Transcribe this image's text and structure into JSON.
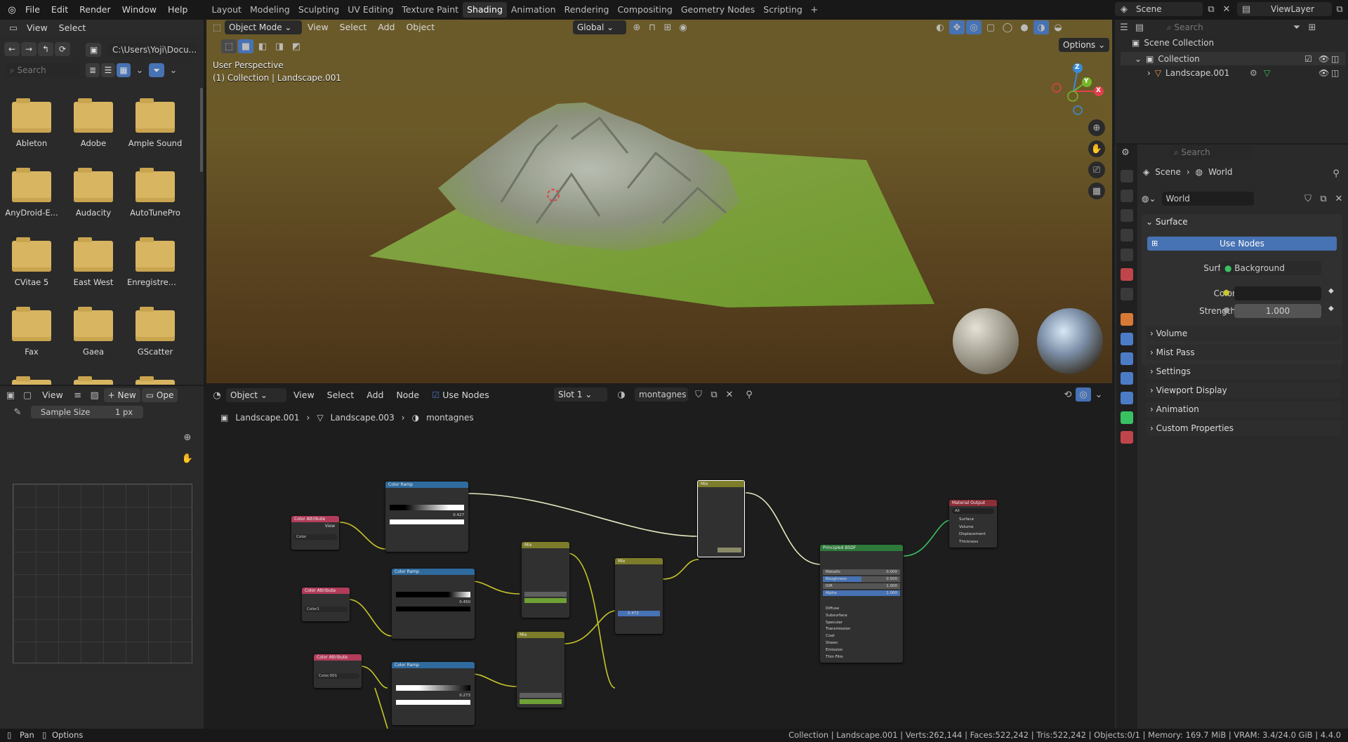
{
  "topbar": {
    "menus": [
      "File",
      "Edit",
      "Render",
      "Window",
      "Help"
    ],
    "workspaces": [
      "Layout",
      "Modeling",
      "Sculpting",
      "UV Editing",
      "Texture Paint",
      "Shading",
      "Animation",
      "Rendering",
      "Compositing",
      "Geometry Nodes",
      "Scripting"
    ],
    "active_workspace": "Shading",
    "scene": "Scene",
    "view_layer": "ViewLayer"
  },
  "file_browser": {
    "menus": [
      "View",
      "Select"
    ],
    "path": "C:\\Users\\Yoji\\Docu...",
    "search_placeholder": "Search",
    "folders": [
      "Ableton",
      "Adobe",
      "Ample Sound",
      "AnyDroid-E...",
      "Audacity",
      "AutoTunePro",
      "CVitae 5",
      "East West",
      "Enregistrem...",
      "Fax",
      "Gaea",
      "GScatter"
    ]
  },
  "viewport": {
    "mode": "Object Mode",
    "menus": [
      "View",
      "Select",
      "Add",
      "Object"
    ],
    "transform": "Global",
    "options": "Options",
    "overlay_line1": "User Perspective",
    "overlay_line2": "(1) Collection | Landscape.001",
    "gizmo": {
      "z": "Z",
      "y": "Y",
      "x": "X"
    }
  },
  "outliner": {
    "search_placeholder": "Search",
    "scene_collection": "Scene Collection",
    "collection": "Collection",
    "object": "Landscape.001"
  },
  "properties": {
    "search_placeholder": "Search",
    "breadcrumb": [
      "Scene",
      "World"
    ],
    "world_name": "World",
    "surface_header": "Surface",
    "use_nodes": "Use Nodes",
    "surface_label": "Surface",
    "surface_value": "Background",
    "color_label": "Color",
    "strength_label": "Strength",
    "strength_value": "1.000",
    "sections": [
      "Volume",
      "Mist Pass",
      "Settings",
      "Viewport Display",
      "Animation",
      "Custom Properties"
    ]
  },
  "image_editor": {
    "view": "View",
    "new": "New",
    "open": "Ope",
    "sample_label": "Sample Size",
    "sample_value": "1 px"
  },
  "node_editor": {
    "object_type": "Object",
    "menus": [
      "View",
      "Select",
      "Add",
      "Node"
    ],
    "use_nodes": "Use Nodes",
    "slot": "Slot 1",
    "material": "montagnes",
    "breadcrumb": [
      "Landscape.001",
      "Landscape.003",
      "montagnes"
    ]
  },
  "nodes": {
    "color_ramp": "Color Ramp",
    "color_attribute": "Color Attribute",
    "mix": "Mix",
    "principled": "Principled BSDF",
    "output": "Material Output",
    "attr_names": [
      "Color",
      "Color1",
      "Color.001"
    ],
    "ramp_pos": [
      "0.427",
      "0.450",
      "0.273"
    ],
    "mix_factor": "0.473",
    "bsdf_rows": [
      [
        "Metallic",
        "0.000"
      ],
      [
        "Roughness",
        "0.500"
      ],
      [
        "IOR",
        "1.000"
      ],
      [
        "Alpha",
        "1.000"
      ]
    ],
    "bsdf_groups": [
      "Diffuse",
      "Subsurface",
      "Specular",
      "Transmission",
      "Coat",
      "Sheen",
      "Emission",
      "Thin Film"
    ],
    "output_target": "All",
    "output_sockets": [
      "Surface",
      "Volume",
      "Displacement",
      "Thickness"
    ]
  },
  "statusbar": {
    "pan": "Pan",
    "options": "Options",
    "info": "Collection | Landscape.001 | Verts:262,144 | Faces:522,242 | Tris:522,242 | Objects:0/1 | Memory: 169.7 MiB | VRAM: 3.4/24.0 GiB | 4.4.0"
  }
}
